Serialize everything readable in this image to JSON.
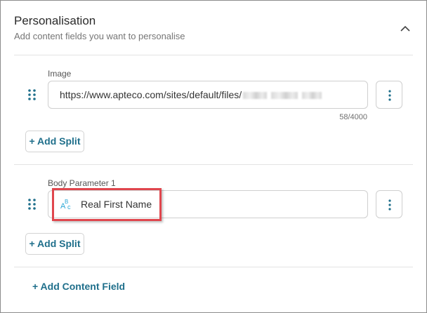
{
  "section": {
    "title": "Personalisation",
    "subtitle": "Add content fields you want to personalise",
    "collapse_icon": "chevron-up-icon"
  },
  "fields": [
    {
      "label": "Image",
      "value": "https://www.apteco.com/sites/default/files/",
      "value_redacted": true,
      "counter": "58/4000",
      "menu_icon": "kebab-menu-icon",
      "add_split_label": "+ Add Split"
    },
    {
      "label": "Body Parameter 1",
      "chip": {
        "icon": "text-field-abc-icon",
        "label": "Real First Name",
        "highlight_color": "#e0464d"
      },
      "menu_icon": "kebab-menu-icon",
      "add_split_label": "+ Add Split"
    }
  ],
  "add_content_field_label": "+ Add Content Field",
  "colors": {
    "accent": "#1f6f8b",
    "icon_blue": "#2aa7d6",
    "highlight": "#e0464d"
  }
}
